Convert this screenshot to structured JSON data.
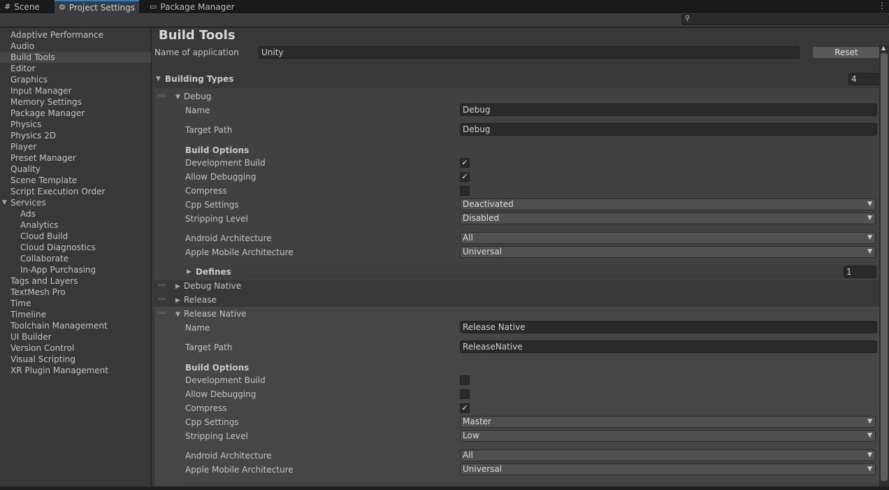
{
  "tabs": [
    {
      "label": "Scene",
      "icon": "scene-grid-icon"
    },
    {
      "label": "Project Settings",
      "icon": "gear-icon"
    },
    {
      "label": "Package Manager",
      "icon": "package-icon"
    }
  ],
  "sidebar": {
    "items": [
      {
        "label": "Adaptive Performance"
      },
      {
        "label": "Audio"
      },
      {
        "label": "Build Tools",
        "selected": true
      },
      {
        "label": "Editor"
      },
      {
        "label": "Graphics"
      },
      {
        "label": "Input Manager"
      },
      {
        "label": "Memory Settings"
      },
      {
        "label": "Package Manager"
      },
      {
        "label": "Physics"
      },
      {
        "label": "Physics 2D"
      },
      {
        "label": "Player"
      },
      {
        "label": "Preset Manager"
      },
      {
        "label": "Quality"
      },
      {
        "label": "Scene Template"
      },
      {
        "label": "Script Execution Order"
      },
      {
        "label": "Services",
        "expanded": true
      },
      {
        "label": "Ads",
        "sub": true
      },
      {
        "label": "Analytics",
        "sub": true
      },
      {
        "label": "Cloud Build",
        "sub": true
      },
      {
        "label": "Cloud Diagnostics",
        "sub": true
      },
      {
        "label": "Collaborate",
        "sub": true
      },
      {
        "label": "In-App Purchasing",
        "sub": true
      },
      {
        "label": "Tags and Layers"
      },
      {
        "label": "TextMesh Pro"
      },
      {
        "label": "Time"
      },
      {
        "label": "Timeline"
      },
      {
        "label": "Toolchain Management"
      },
      {
        "label": "UI Builder"
      },
      {
        "label": "Version Control"
      },
      {
        "label": "Visual Scripting"
      },
      {
        "label": "XR Plugin Management"
      }
    ]
  },
  "main": {
    "title": "Build Tools",
    "app_name_label": "Name of application",
    "app_name_value": "Unity",
    "reset_label": "Reset",
    "building_types_label": "Building Types",
    "building_types_count": "4",
    "debug": {
      "header": "Debug",
      "name_label": "Name",
      "name_value": "Debug",
      "target_label": "Target Path",
      "target_value": "Debug",
      "build_options_label": "Build Options",
      "dev_build_label": "Development Build",
      "dev_build_checked": true,
      "allow_debug_label": "Allow Debugging",
      "allow_debug_checked": true,
      "compress_label": "Compress",
      "compress_checked": false,
      "cpp_label": "Cpp Settings",
      "cpp_value": "Deactivated",
      "strip_label": "Stripping Level",
      "strip_value": "Disabled",
      "android_label": "Android Architecture",
      "android_value": "All",
      "apple_label": "Apple Mobile Architecture",
      "apple_value": "Universal",
      "defines_label": "Defines",
      "defines_count": "1"
    },
    "debug_native_header": "Debug Native",
    "release_header": "Release",
    "release_native": {
      "header": "Release Native",
      "name_label": "Name",
      "name_value": "Release Native",
      "target_label": "Target Path",
      "target_value": "ReleaseNative",
      "build_options_label": "Build Options",
      "dev_build_label": "Development Build",
      "dev_build_checked": false,
      "allow_debug_label": "Allow Debugging",
      "allow_debug_checked": false,
      "compress_label": "Compress",
      "compress_checked": true,
      "cpp_label": "Cpp Settings",
      "cpp_value": "Master",
      "strip_label": "Stripping Level",
      "strip_value": "Low",
      "android_label": "Android Architecture",
      "android_value": "All",
      "apple_label": "Apple Mobile Architecture",
      "apple_value": "Universal"
    }
  }
}
